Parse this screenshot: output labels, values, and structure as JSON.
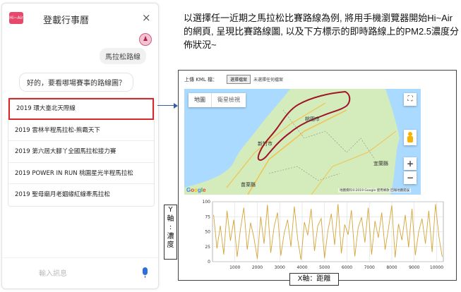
{
  "phone": {
    "logo_text": "Hi~Air",
    "title": "登載行事曆",
    "close_glyph": "×",
    "avatar_glyph": "♟",
    "user_message": "馬拉松路線",
    "bot_message": "好的，要看哪場賽事的路線圖？",
    "options": [
      "2019 環大臺北天際線",
      "2019 雲林半程馬拉松-熊霸天下",
      "2019 第六屆大腳丫全國馬拉松接力賽",
      "2019 POWER IN RUN 桃園星光半程馬拉松",
      "2019 聖母廟月老姻緣紅線牽馬拉松"
    ],
    "selected_index": 0,
    "input_placeholder": "輸入訊息"
  },
  "description": "以選擇任一近期之馬拉松比賽路線為例, 將用手機瀏覽器開始Hi~Air的網頁, 呈現比賽路線圖, 以及下方標示的即時路線上的PM2.5濃度分佈狀況~",
  "screenshot": {
    "kml_label": "上傳 KML 檔：",
    "kml_button": "選擇檔案",
    "kml_status": "未選擇任何檔案",
    "map": {
      "tabs": [
        "地圖",
        "衛星檢視"
      ],
      "fullscreen_glyph": "⛶",
      "zoom_in": "+",
      "zoom_out": "−",
      "logo": "Google",
      "copyright": "地圖資料©2019 Google   使用條款   回報地圖錯誤",
      "places": [
        "桃園市",
        "新竹市",
        "宜蘭縣",
        "苗栗縣"
      ],
      "colors": {
        "land": "#d4ecbb",
        "sea": "#aadaff",
        "route": "#a01428",
        "road": "#f2c14e"
      }
    }
  },
  "chart_data": {
    "type": "line",
    "xlim": [
      0,
      10300
    ],
    "ylim": [
      0,
      100
    ],
    "xticks": [
      1000,
      2000,
      3000,
      4000,
      5000,
      6000,
      7000,
      8000,
      9000,
      10000
    ],
    "yticks": [
      0,
      25,
      50,
      75,
      100
    ],
    "grid": true,
    "line_color": "#d4a537",
    "series": [
      {
        "x": [
          50,
          200,
          350,
          500,
          650,
          800,
          950,
          1100,
          1250,
          1400,
          1550,
          1700,
          1850,
          2000,
          2150,
          2300,
          2450,
          2600,
          2750,
          2900,
          3050,
          3200,
          3350,
          3500,
          3650,
          3800,
          3950,
          4100,
          4250,
          4400,
          4550,
          4700,
          4850,
          5000,
          5150,
          5300,
          5450,
          5600,
          5750,
          5900,
          6050,
          6200,
          6350,
          6500,
          6650,
          6800,
          6950,
          7100,
          7250,
          7400,
          7550,
          7700,
          7850,
          8000,
          8150,
          8300,
          8450,
          8600,
          8750,
          8900,
          9050,
          9200,
          9350,
          9500,
          9650,
          9800,
          9950,
          10100,
          10250
        ],
        "values": [
          78,
          22,
          60,
          12,
          85,
          35,
          70,
          8,
          55,
          90,
          20,
          65,
          40,
          5,
          75,
          30,
          95,
          15,
          58,
          82,
          10,
          48,
          70,
          25,
          92,
          38,
          3,
          66,
          44,
          88,
          18,
          60,
          72,
          6,
          52,
          80,
          28,
          96,
          14,
          62,
          45,
          86,
          9,
          57,
          74,
          32,
          90,
          12,
          68,
          40,
          82,
          20,
          55,
          94,
          7,
          63,
          36,
          78,
          24,
          88,
          11,
          50,
          72,
          30,
          85,
          16,
          96,
          42,
          8
        ]
      }
    ]
  },
  "annotations": {
    "y_axis_label": "Y軸：濃度",
    "x_axis_label": "X軸：距離"
  }
}
